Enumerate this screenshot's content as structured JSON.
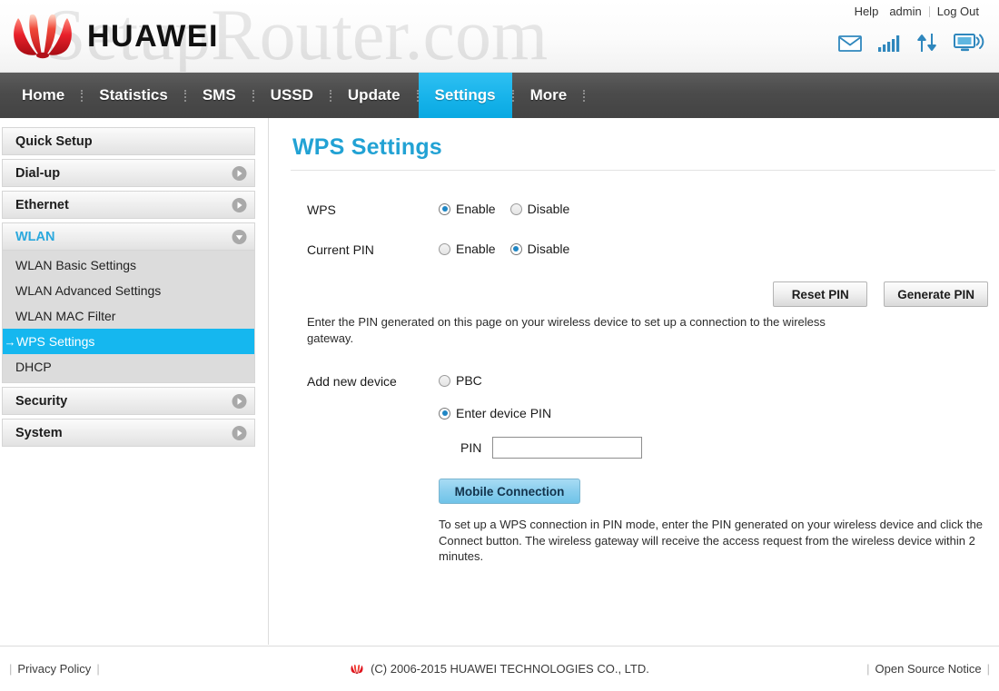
{
  "header": {
    "brand": "HUAWEI",
    "brand_logo_icon": "huawei-flower-logo",
    "watermark": "SetupRouter.com",
    "links": [
      {
        "label": "Help",
        "name": "help-link"
      },
      {
        "label": "admin",
        "name": "admin-link"
      },
      {
        "label": "Log Out",
        "name": "logout-link"
      }
    ],
    "status_icons": [
      {
        "name": "envelope-icon",
        "label": "sms-messages"
      },
      {
        "name": "signal-bars-icon",
        "label": "signal-strength"
      },
      {
        "name": "data-transfer-icon",
        "label": "upload-download"
      },
      {
        "name": "device-broadcast-icon",
        "label": "connected-devices"
      }
    ]
  },
  "nav": {
    "items": [
      {
        "label": "Home",
        "active": false
      },
      {
        "label": "Statistics",
        "active": false
      },
      {
        "label": "SMS",
        "active": false
      },
      {
        "label": "USSD",
        "active": false
      },
      {
        "label": "Update",
        "active": false
      },
      {
        "label": "Settings",
        "active": true
      },
      {
        "label": "More",
        "active": false
      }
    ],
    "active_color": "#17b3ea",
    "bar_color": "#4b4b4b"
  },
  "sidebar": {
    "groups": [
      {
        "label": "Quick Setup",
        "expandable": false,
        "expanded": false,
        "name": "sidebar-item-quick-setup"
      },
      {
        "label": "Dial-up",
        "expandable": true,
        "expanded": false,
        "name": "sidebar-item-dial-up"
      },
      {
        "label": "Ethernet",
        "expandable": true,
        "expanded": false,
        "name": "sidebar-item-ethernet"
      },
      {
        "label": "WLAN",
        "expandable": true,
        "expanded": true,
        "name": "sidebar-item-wlan",
        "children": [
          {
            "label": "WLAN Basic Settings",
            "active": false,
            "name": "sidebar-item-wlan-basic-settings"
          },
          {
            "label": "WLAN Advanced Settings",
            "active": false,
            "name": "sidebar-item-wlan-advanced-settings"
          },
          {
            "label": "WLAN MAC Filter",
            "active": false,
            "name": "sidebar-item-wlan-mac-filter"
          },
          {
            "label": "WPS Settings",
            "active": true,
            "name": "sidebar-item-wps-settings"
          },
          {
            "label": "DHCP",
            "active": false,
            "name": "sidebar-item-dhcp"
          }
        ]
      },
      {
        "label": "Security",
        "expandable": true,
        "expanded": false,
        "name": "sidebar-item-security"
      },
      {
        "label": "System",
        "expandable": true,
        "expanded": false,
        "name": "sidebar-item-system"
      }
    ],
    "active_marker": "→",
    "active_color": "#15b7ef"
  },
  "main": {
    "title": "WPS Settings",
    "title_color": "#22a2d4",
    "rows": {
      "wps": {
        "label": "WPS",
        "options": [
          {
            "label": "Enable",
            "selected": true
          },
          {
            "label": "Disable",
            "selected": false
          }
        ]
      },
      "current_pin": {
        "label": "Current PIN",
        "options": [
          {
            "label": "Enable",
            "selected": false
          },
          {
            "label": "Disable",
            "selected": true
          }
        ]
      },
      "add_new_device": {
        "label": "Add new device",
        "options": [
          {
            "label": "PBC",
            "selected": false
          },
          {
            "label": "Enter device PIN",
            "selected": true
          }
        ]
      }
    },
    "buttons": {
      "reset_pin": "Reset PIN",
      "generate_pin": "Generate PIN",
      "mobile_connection": "Mobile Connection"
    },
    "pin_field": {
      "label": "PIN",
      "value": "",
      "placeholder": ""
    },
    "help_pin": "Enter the PIN generated on this page on your wireless device to set up a connection to the wireless gateway.",
    "help_connect": "To set up a WPS connection in PIN mode, enter the PIN generated on your wireless device and click the Connect button. The wireless gateway will receive the access request from the wireless device within 2 minutes."
  },
  "footer": {
    "privacy_policy": "Privacy Policy",
    "copyright": "(C) 2006-2015 HUAWEI TECHNOLOGIES CO., LTD.",
    "open_source_notice": "Open Source Notice",
    "bar": "|"
  }
}
